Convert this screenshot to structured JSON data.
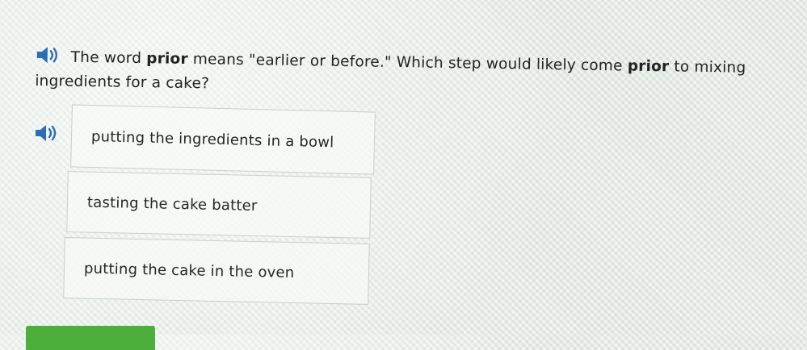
{
  "question": {
    "part1": "The word ",
    "bold1": "prior",
    "part2": " means \"earlier or before.\" Which step would likely come ",
    "bold2": "prior",
    "part3": " to mixing ingredients for a cake?"
  },
  "choices": [
    {
      "label": "putting the ingredients in a bowl"
    },
    {
      "label": "tasting the cake batter"
    },
    {
      "label": "putting the cake in the oven"
    }
  ],
  "colors": {
    "speaker": "#2d6db5",
    "submit": "#4caf3c"
  },
  "icons": {
    "question_audio": "speaker-icon",
    "choice_audio": "speaker-icon"
  }
}
